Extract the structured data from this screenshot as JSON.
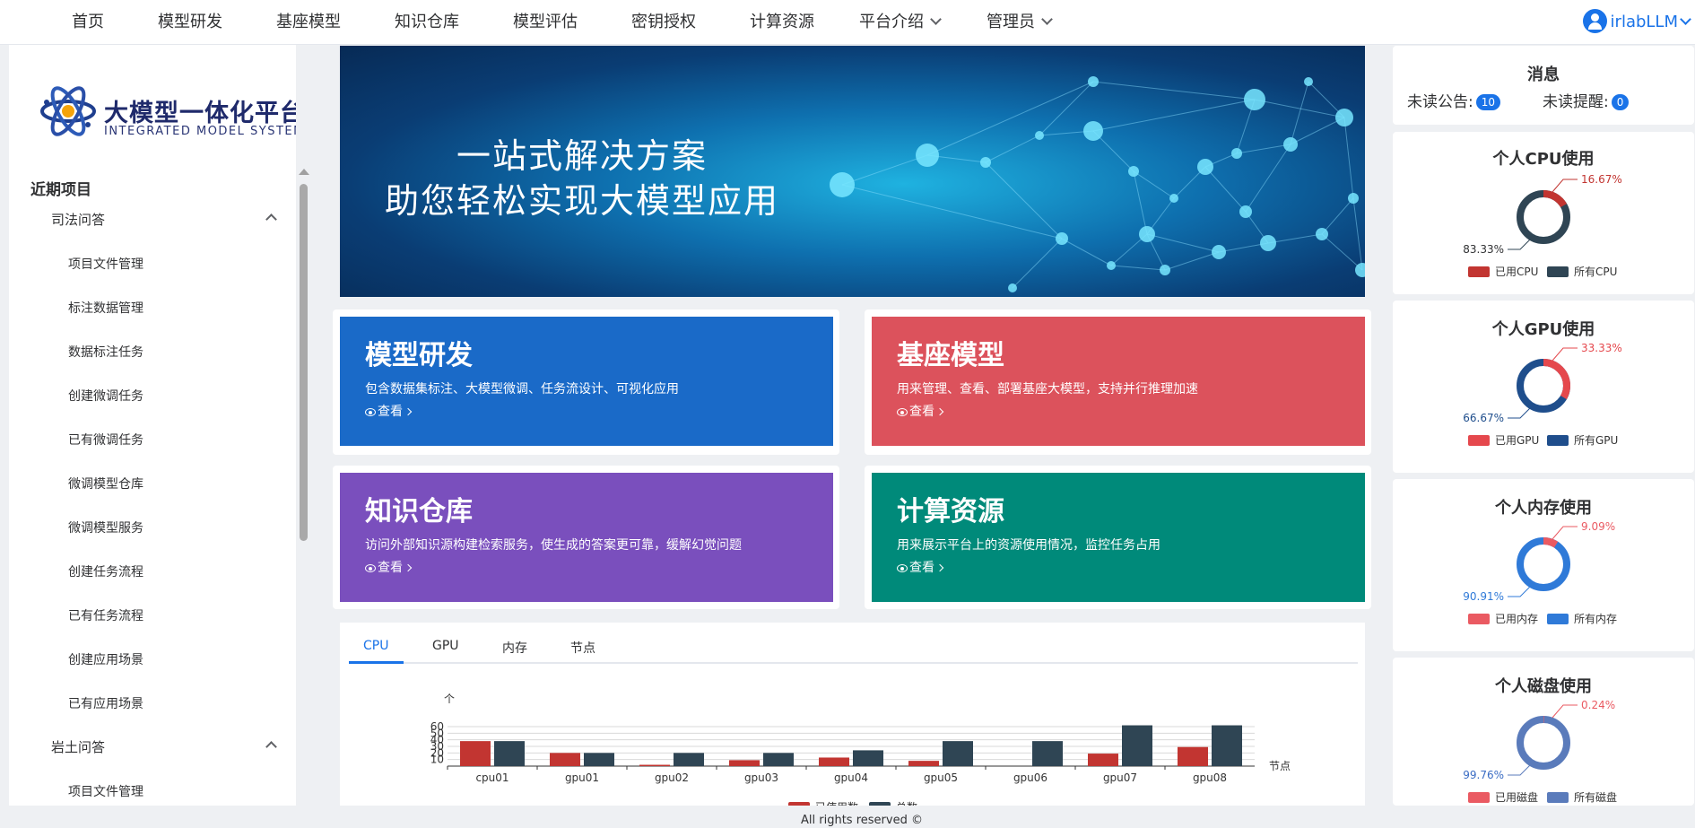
{
  "nav": {
    "items": [
      "首页",
      "模型研发",
      "基座模型",
      "知识仓库",
      "模型评估",
      "密钥授权",
      "计算资源"
    ],
    "dropdowns": [
      "平台介绍",
      "管理员"
    ],
    "user": "irlabLLM"
  },
  "logo": {
    "title": "大模型一体化平台",
    "subtitle": "INTEGRATED MODEL SYSTEM"
  },
  "sidebar": {
    "section": "近期项目",
    "groups": [
      {
        "label": "司法问答",
        "items": [
          "项目文件管理",
          "标注数据管理",
          "数据标注任务",
          "创建微调任务",
          "已有微调任务",
          "微调模型仓库",
          "微调模型服务",
          "创建任务流程",
          "已有任务流程",
          "创建应用场景",
          "已有应用场景"
        ]
      },
      {
        "label": "岩土问答",
        "items": [
          "项目文件管理"
        ]
      }
    ]
  },
  "banner": {
    "line1": "一站式解决方案",
    "line2": "助您轻松实现大模型应用"
  },
  "cards": [
    {
      "title": "模型研发",
      "desc": "包含数据集标注、大模型微调、任务流设计、可视化应用",
      "link": "查看",
      "color": "#1a6ac8"
    },
    {
      "title": "基座模型",
      "desc": "用来管理、查看、部署基座大模型，支持并行推理加速",
      "link": "查看",
      "color": "#dc525c"
    },
    {
      "title": "知识仓库",
      "desc": "访问外部知识源构建检索服务，使生成的答案更可靠，缓解幻觉问题",
      "link": "查看",
      "color": "#7a4fbd"
    },
    {
      "title": "计算资源",
      "desc": "用来展示平台上的资源使用情况，监控任务占用",
      "link": "查看",
      "color": "#008a7a"
    }
  ],
  "tabs": [
    "CPU",
    "GPU",
    "内存",
    "节点"
  ],
  "chart_data": {
    "type": "bar",
    "categories": [
      "cpu01",
      "gpu01",
      "gpu02",
      "gpu03",
      "gpu04",
      "gpu05",
      "gpu06",
      "gpu07",
      "gpu08"
    ],
    "series": [
      {
        "name": "已使用数",
        "values": [
          38,
          20,
          2,
          9,
          13,
          8,
          0,
          19,
          29
        ],
        "color": "#c23531"
      },
      {
        "name": "总数",
        "values": [
          38,
          20,
          20,
          20,
          24,
          38,
          38,
          62,
          62
        ],
        "color": "#2f4554"
      }
    ],
    "yticks": [
      "60",
      "50",
      "40",
      "30",
      "20",
      "10"
    ],
    "ylabel": "个",
    "xlabel": "节点",
    "ylim": [
      0,
      60
    ],
    "grid": true,
    "legend": "bottom"
  },
  "messages": {
    "title": "消息",
    "unread_notice_label": "未读公告:",
    "unread_notice": "10",
    "unread_remind_label": "未读提醒:",
    "unread_remind": "0"
  },
  "usage": [
    {
      "title": "个人CPU使用",
      "used_pct": "16.67%",
      "total_pct": "83.33%",
      "used_frac": 0.1667,
      "legend_used": "已用CPU",
      "legend_total": "所有CPU",
      "used_color": "#c23531",
      "total_color": "#2f4554",
      "label_used_color": "#c23531",
      "label_total_color": "#303133"
    },
    {
      "title": "个人GPU使用",
      "used_pct": "33.33%",
      "total_pct": "66.67%",
      "used_frac": 0.3333,
      "legend_used": "已用GPU",
      "legend_total": "所有GPU",
      "used_color": "#e5484d",
      "total_color": "#1f4e8c",
      "label_used_color": "#e5484d",
      "label_total_color": "#1f4e8c"
    },
    {
      "title": "个人内存使用",
      "used_pct": "9.09%",
      "total_pct": "90.91%",
      "used_frac": 0.0909,
      "legend_used": "已用内存",
      "legend_total": "所有内存",
      "used_color": "#ea5a62",
      "total_color": "#2f7ad8",
      "label_used_color": "#ea5a62",
      "label_total_color": "#2f7ad8"
    },
    {
      "title": "个人磁盘使用",
      "used_pct": "0.24%",
      "total_pct": "99.76%",
      "used_frac": 0.0024,
      "legend_used": "已用磁盘",
      "legend_total": "所有磁盘",
      "used_color": "#ea5a62",
      "total_color": "#5a7bbb",
      "label_used_color": "#ea5a62",
      "label_total_color": "#3a6cc4"
    }
  ],
  "footer": "All rights reserved ©"
}
